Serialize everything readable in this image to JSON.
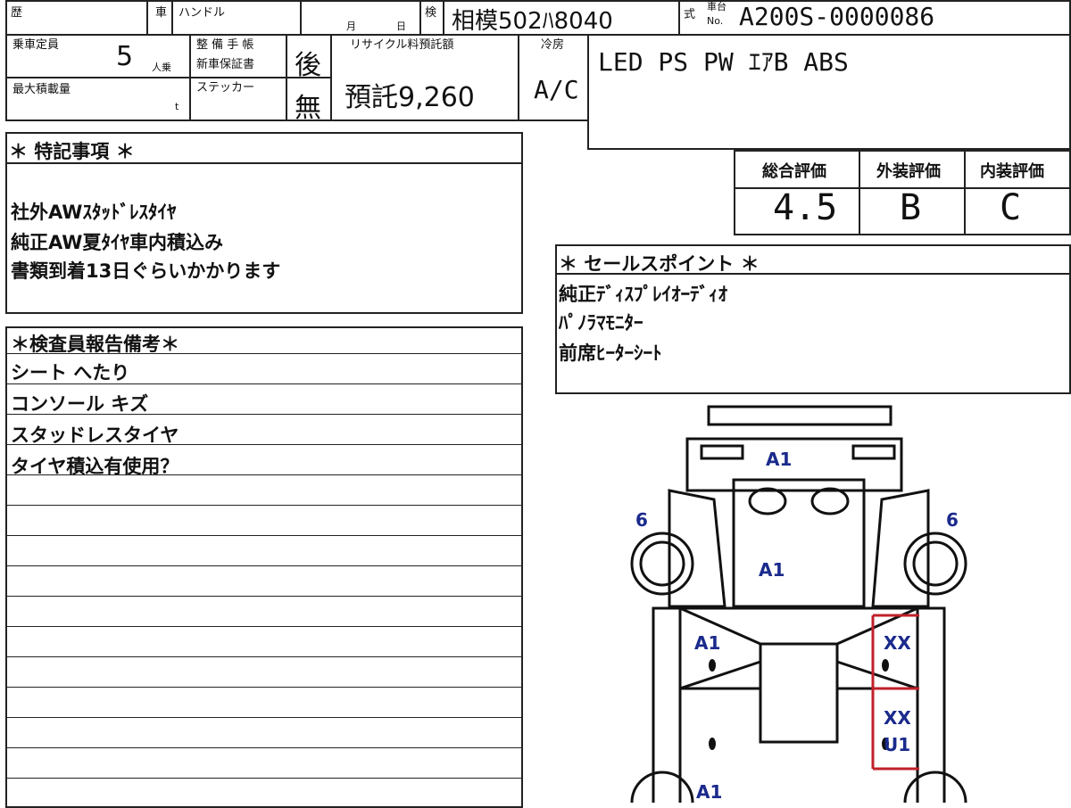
{
  "header": {
    "history_label": "歴",
    "car_label": "車",
    "handle_label": "ハンドル",
    "month_label": "月",
    "day_label": "日",
    "inspection_label": "検",
    "plate": "相模502ﾊ8040",
    "type_label": "式",
    "chassis_label_1": "車台",
    "chassis_label_2": "No.",
    "chassis_no": "A200S-0000086"
  },
  "spec": {
    "capacity_label": "乗車定員",
    "capacity_value": "5",
    "capacity_unit": "人乗",
    "max_load_label": "最大積載量",
    "max_load_unit": "t",
    "maintenance_label_1": "整 備 手 帳",
    "maintenance_label_2": "新車保証書",
    "maintenance_value": "後",
    "sticker_label": "ステッカー",
    "sticker_value": "無",
    "recycle_label": "リサイクル料預託額",
    "recycle_value": "預託9,260",
    "cooler_label": "冷房",
    "cooler_value": "A/C",
    "equipment": "LED PS PW ｴｱB ABS"
  },
  "scores": {
    "overall_label": "総合評価",
    "overall_value": "4.5",
    "exterior_label": "外装評価",
    "exterior_value": "B",
    "interior_label": "内装評価",
    "interior_value": "C"
  },
  "special_notes": {
    "title": "＊ 特記事項 ＊",
    "lines": [
      "社外AWｽﾀｯﾄﾞﾚｽﾀｲﾔ",
      "純正AW夏ﾀｲﾔ車内積込み",
      "書類到着13日ぐらいかかります"
    ]
  },
  "sales_points": {
    "title": "＊ セールスポイント ＊",
    "lines": [
      "純正ﾃﾞｨｽﾌﾟﾚｲｵｰﾃﾞｨｵ",
      "ﾊﾟﾉﾗﾏﾓﾆﾀｰ",
      "前席ﾋｰﾀｰｼｰﾄ"
    ]
  },
  "inspector_report": {
    "title": "＊検査員報告備考＊",
    "lines": [
      "シート へたり",
      "コンソール キズ",
      "スタッドレスタイヤ",
      "タイヤ積込有使用？"
    ]
  },
  "diagram": {
    "marks": {
      "front_bumper": "A1",
      "hood": "A1",
      "left_front_tire": "6",
      "right_front_tire": "6",
      "left_front_door": "A1",
      "right_front_door": "XX",
      "right_rear_door_1": "XX",
      "right_rear_door_2": "U1",
      "left_rear": "A1"
    },
    "mark_color": "#1a2a8c",
    "damage_color": "#c0202a"
  }
}
